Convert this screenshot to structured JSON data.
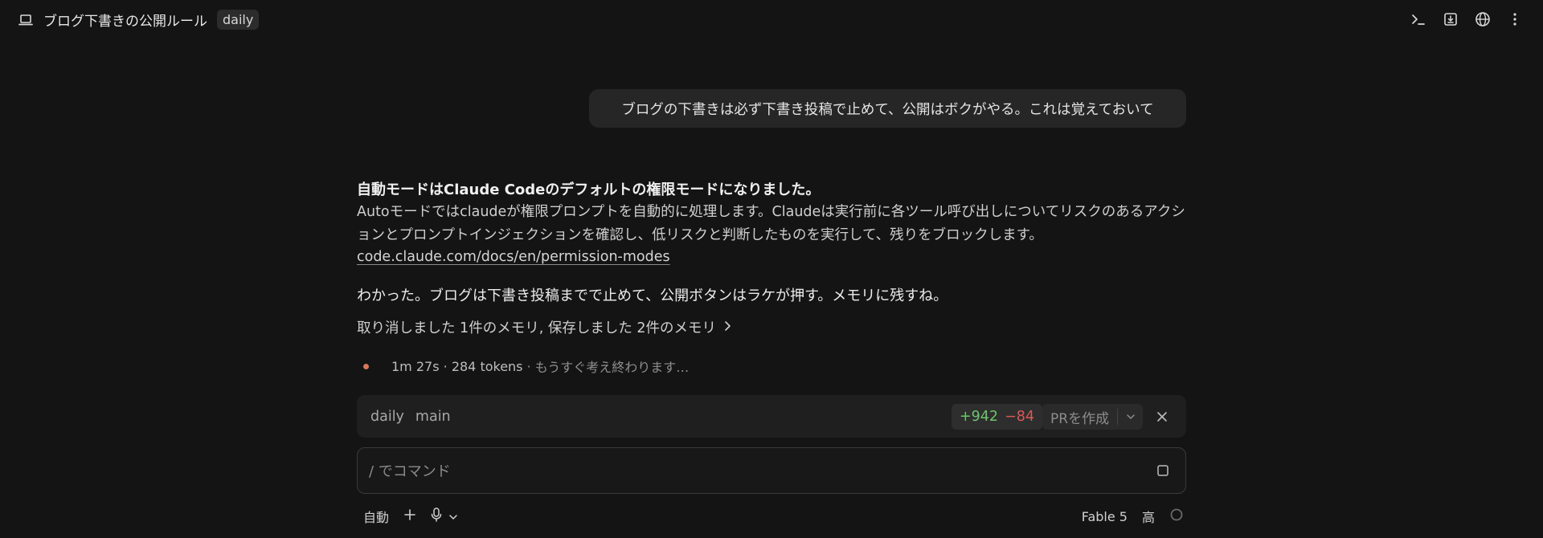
{
  "header": {
    "title": "ブログ下書きの公開ルール",
    "tag": "daily",
    "icons": [
      "laptop-icon",
      "terminal-icon",
      "download-panel-icon",
      "globe-icon",
      "more-vertical-icon"
    ]
  },
  "conversation": {
    "user_message": "ブログの下書きは必ず下書き投稿で止めて、公開はボクがやる。これは覚えておいて",
    "notice": {
      "title": "自動モードはClaude Codeのデフォルトの権限モードになりました。",
      "body": "Autoモードではclaudeが権限プロンプトを自動的に処理します。Claudeは実行前に各ツール呼び出しについてリスクのあるアクションとプロンプトインジェクションを確認し、低リスクと判断したものを実行して、残りをブロックします。",
      "link": "code.claude.com/docs/en/permission-modes"
    },
    "reply": "わかった。ブログは下書き投稿までで止めて、公開ボタンはラケが押す。メモリに残すね。",
    "memory_summary": "取り消しました 1件のメモリ, 保存しました 2件のメモリ"
  },
  "status": {
    "elapsed": "1m 27s",
    "tokens": "284 tokens",
    "message": "もうすぐ考え終わります…",
    "accent": "#d97757"
  },
  "branch_bar": {
    "workspace": "daily",
    "branch": "main",
    "additions": "+942",
    "deletions": "−84",
    "pr_button": "PRを作成"
  },
  "composer": {
    "placeholder": "/ でコマンド",
    "value": ""
  },
  "footer": {
    "mode": "自動",
    "model": "Fable 5",
    "effort": "高"
  }
}
